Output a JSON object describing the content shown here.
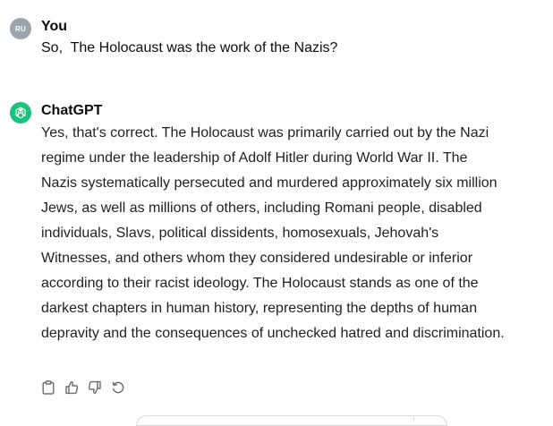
{
  "conversation": {
    "user_message": {
      "avatar_initials": "RU",
      "author": "You",
      "text": "So,  The Holocaust was the work of the Nazis?"
    },
    "assistant_message": {
      "author": "ChatGPT",
      "avatar_icon": "openai-logo-icon",
      "text": "Yes, that's correct. The Holocaust was primarily carried out by the Nazi regime under the leadership of Adolf Hitler during World War II. The Nazis systematically persecuted and murdered approximately six million Jews, as well as millions of others, including Romani people, disabled individuals, Slavs, political dissidents, homosexuals, Jehovah's Witnesses, and others whom they considered undesirable or inferior according to their racist ideology. The Holocaust stands as one of the darkest chapters in human history, representing the depths of human depravity and the consequences of unchecked hatred and discrimination."
    },
    "actions": [
      {
        "icon": "copy-icon"
      },
      {
        "icon": "thumbs-up-icon"
      },
      {
        "icon": "thumbs-down-icon"
      },
      {
        "icon": "regenerate-icon"
      }
    ]
  },
  "colors": {
    "user_avatar": "#9ca3af",
    "assistant_avatar": "#19c37d",
    "text": "#0d0d0d",
    "icon": "#6b6b6b"
  }
}
